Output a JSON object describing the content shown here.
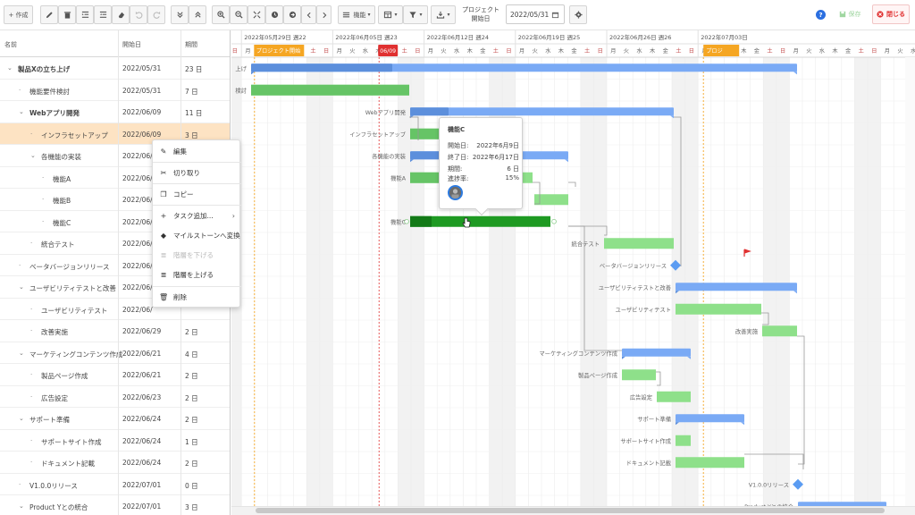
{
  "toolbar": {
    "new_label": "+ 作成",
    "filter_label": "機能",
    "project_date_label_1": "プロジェクト",
    "project_date_label_2": "開始日",
    "project_date_value": "2022/05/31",
    "save_label": "保存",
    "close_label": "閉じる",
    "help_label": "?"
  },
  "grid": {
    "headers": {
      "name": "名前",
      "start": "開始日",
      "duration": "期間"
    },
    "rows": [
      {
        "name": "製品Xの立ち上げ",
        "start": "2022/05/31",
        "duration": "23 日",
        "level": 0,
        "expanded": true,
        "bold": true
      },
      {
        "name": "機能要件検討",
        "start": "2022/05/31",
        "duration": "7 日",
        "level": 1
      },
      {
        "name": "Webアプリ開発",
        "start": "2022/06/09",
        "duration": "11 日",
        "level": 1,
        "expanded": true,
        "bold": true
      },
      {
        "name": "インフラセットアップ",
        "start": "2022/06/09",
        "duration": "3 日",
        "level": 2,
        "selected": true
      },
      {
        "name": "各機能の実装",
        "start": "2022/06/",
        "duration": "",
        "level": 2,
        "expanded": true
      },
      {
        "name": "機能A",
        "start": "2022/06/",
        "duration": "",
        "level": 3
      },
      {
        "name": "機能B",
        "start": "2022/06/",
        "duration": "",
        "level": 3
      },
      {
        "name": "機能C",
        "start": "2022/06/",
        "duration": "",
        "level": 3
      },
      {
        "name": "統合テスト",
        "start": "2022/06/",
        "duration": "",
        "level": 2
      },
      {
        "name": "ベータバージョンリリース",
        "start": "2022/06/",
        "duration": "",
        "level": 1
      },
      {
        "name": "ユーザビリティテストと改善",
        "start": "2022/06/",
        "duration": "",
        "level": 1,
        "expanded": true
      },
      {
        "name": "ユーザビリティテスト",
        "start": "2022/06/",
        "duration": "",
        "level": 2
      },
      {
        "name": "改善実施",
        "start": "2022/06/29",
        "duration": "2 日",
        "level": 2
      },
      {
        "name": "マーケティングコンテンツ作成",
        "start": "2022/06/21",
        "duration": "4 日",
        "level": 1,
        "expanded": true
      },
      {
        "name": "製品ページ作成",
        "start": "2022/06/21",
        "duration": "2 日",
        "level": 2
      },
      {
        "name": "広告設定",
        "start": "2022/06/23",
        "duration": "2 日",
        "level": 2
      },
      {
        "name": "サポート準備",
        "start": "2022/06/24",
        "duration": "2 日",
        "level": 1,
        "expanded": true
      },
      {
        "name": "サポートサイト作成",
        "start": "2022/06/24",
        "duration": "1 日",
        "level": 2
      },
      {
        "name": "ドキュメント記載",
        "start": "2022/06/24",
        "duration": "2 日",
        "level": 2
      },
      {
        "name": "V1.0.0リリース",
        "start": "2022/07/01",
        "duration": "0 日",
        "level": 1
      },
      {
        "name": "Product Yとの統合",
        "start": "2022/07/01",
        "duration": "3 日",
        "level": 1,
        "expanded": true
      }
    ]
  },
  "timeline": {
    "weeks": [
      "2022年05月29日 週22",
      "2022年06月05日 週23",
      "2022年06月12日 週24",
      "2022年06月19日 週25",
      "2022年06月26日 週26",
      "2022年07月03日"
    ],
    "day_labels": [
      "月",
      "火",
      "水",
      "木",
      "金",
      "土",
      "日"
    ],
    "project_start_marker": "プロジェクト開始",
    "today_marker": "06/09",
    "end_marker": "プロジ"
  },
  "bars": [
    {
      "label": "上げ"
    },
    {
      "label": "検討"
    },
    {
      "label": "Webアプリ開発"
    },
    {
      "label": "インフラセットアップ"
    },
    {
      "label": "各機能の実装"
    },
    {
      "label": "機能A"
    },
    {
      "label": "機能C"
    },
    {
      "label": "統合テスト"
    },
    {
      "label": "ベータバージョンリリース"
    },
    {
      "label": "ユーザビリティテストと改善"
    },
    {
      "label": "ユーザビリティテスト"
    },
    {
      "label": "改善実施"
    },
    {
      "label": "マーケティングコンテンツ作成"
    },
    {
      "label": "製品ページ作成"
    },
    {
      "label": "広告設定"
    },
    {
      "label": "サポート準備"
    },
    {
      "label": "サポートサイト作成"
    },
    {
      "label": "ドキュメント記載"
    },
    {
      "label": "V1.0.0リリース"
    },
    {
      "label": "Product Yとの統合"
    }
  ],
  "context_menu": {
    "edit": "編集",
    "cut": "切り取り",
    "copy": "コピー",
    "add_task": "タスク追加...",
    "to_milestone": "マイルストーンへ変換",
    "outdent_disabled": "階層を下げる",
    "indent": "階層を上げる",
    "delete": "削除"
  },
  "tooltip": {
    "title": "機能C",
    "start_label": "開始日:",
    "start_value": "2022年6月9日",
    "end_label": "終了日:",
    "end_value": "2022年6月17日",
    "duration_label": "期間:",
    "duration_value": "6 日",
    "progress_label": "進捗率:",
    "progress_value": "15%"
  },
  "colors": {
    "summary_bar": "#7aaaf5",
    "summary_progress": "#5c8fdc",
    "task_bar": "#8ee08a",
    "task_progress": "#55b857",
    "selected_task": "#1e9a22",
    "milestone": "#5b9cf2",
    "today_line": "#e03030",
    "project_marker": "#f5a623",
    "weekend_fill": "#f2f2f2"
  }
}
